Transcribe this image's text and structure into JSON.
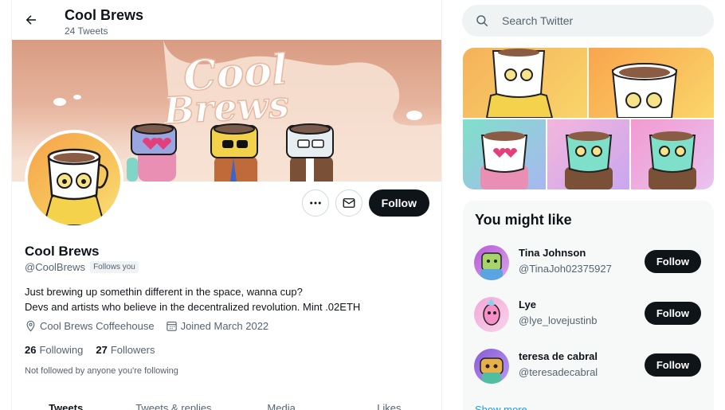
{
  "header": {
    "title": "Cool Brews",
    "tweet_count": "24 Tweets"
  },
  "banner": {
    "logo_line1": "Cool",
    "logo_line2": "Brews"
  },
  "profile": {
    "name": "Cool Brews",
    "handle": "@CoolBrews",
    "follows_you": "Follows you",
    "bio_line1": "Just brewing up somethin different in the space, wanna cup?",
    "bio_line2": "Devs and artists who believe in the decentralized revolution. Mint .02ETH",
    "location": "Cool Brews Coffeehouse",
    "joined": "Joined March 2022",
    "following_count": "26",
    "following_label": "Following",
    "followers_count": "27",
    "followers_label": "Followers",
    "not_followed": "Not followed by anyone you're following"
  },
  "actions": {
    "follow_label": "Follow"
  },
  "tabs": [
    {
      "label": "Tweets"
    },
    {
      "label": "Tweets & replies"
    },
    {
      "label": "Media"
    },
    {
      "label": "Likes"
    }
  ],
  "search": {
    "placeholder": "Search Twitter"
  },
  "suggestions": {
    "title": "You might like",
    "users": [
      {
        "name": "Tina Johnson",
        "handle": "@TinaJoh02375927",
        "follow_label": "Follow"
      },
      {
        "name": "Lye",
        "handle": "@lye_lovejustinb",
        "follow_label": "Follow"
      },
      {
        "name": "teresa de cabral",
        "handle": "@teresadecabral",
        "follow_label": "Follow"
      }
    ],
    "show_more": "Show more"
  },
  "colors": {
    "accent": "#1d9bf0",
    "dark": "#0f1419",
    "muted": "#536471"
  }
}
